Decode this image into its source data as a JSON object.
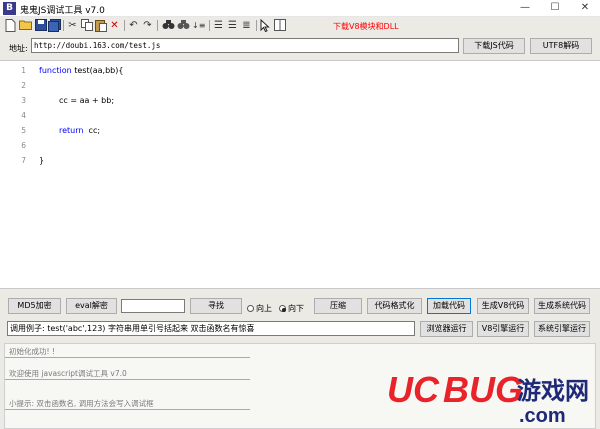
{
  "window": {
    "title": "鬼鬼JS调试工具 v7.0",
    "icon_letter": "B",
    "controls": [
      "—",
      "☐",
      "✕"
    ]
  },
  "toolbar": {
    "icons": [
      "new-file",
      "open-folder",
      "save",
      "save-all",
      "cut",
      "copy",
      "paste",
      "delete",
      "undo",
      "redo",
      "find",
      "find-replace",
      "sort",
      "indent",
      "pointer",
      "columns"
    ],
    "link_text": "下载V8模块和DLL"
  },
  "address": {
    "label": "地址:",
    "value": "http://doubi.163.com/test.js",
    "download_button": "下载JS代码",
    "utf8_button": "UTF8解码"
  },
  "editor": {
    "lines": [
      {
        "num": "1",
        "parts": [
          {
            "t": "function",
            "kw": true
          },
          {
            "t": " test(aa,bb){",
            "kw": false
          }
        ]
      },
      {
        "num": "2",
        "parts": []
      },
      {
        "num": "3",
        "parts": [
          {
            "t": "cc = aa + bb;",
            "kw": false
          }
        ]
      },
      {
        "num": "4",
        "parts": []
      },
      {
        "num": "5",
        "parts": [
          {
            "t": "return",
            "kw": true
          },
          {
            "t": "  cc;",
            "kw": false
          }
        ]
      },
      {
        "num": "6",
        "parts": []
      },
      {
        "num": "7",
        "parts": [
          {
            "t": "}",
            "kw": false
          }
        ]
      }
    ]
  },
  "controls": {
    "md5_button": "MD5加密",
    "eval_button": "eval解密",
    "search_value": "",
    "find_button": "寻找",
    "radio_up": "向上",
    "radio_down": "向下",
    "radio_selected": "down",
    "compress_button": "压缩",
    "format_button": "代码格式化",
    "load_button": "加载代码",
    "gen_v8_button": "生成V8代码",
    "gen_sys_button": "生成系统代码",
    "call_example": "调用例子: test('abc',123) 字符串用单引号括起来 双击函数名有惊喜",
    "browser_run": "浏览器运行",
    "v8_run": "V8引擎运行",
    "sys_run": "系统引擎运行"
  },
  "output": {
    "lines": [
      "初始化成功! !",
      "欢迎使用 javascript调试工具 v7.0",
      "小提示: 双击函数名, 调用方法会写入调试框"
    ]
  },
  "watermark": {
    "brand_uc": "UC",
    "brand_bug": "BUG",
    "brand_cn": "游戏网",
    "domain": ".com",
    "colors": {
      "uc": "#e8232a",
      "bug": "#e8232a",
      "cn": "#1e2a78",
      "domain": "#1e2a78"
    }
  }
}
